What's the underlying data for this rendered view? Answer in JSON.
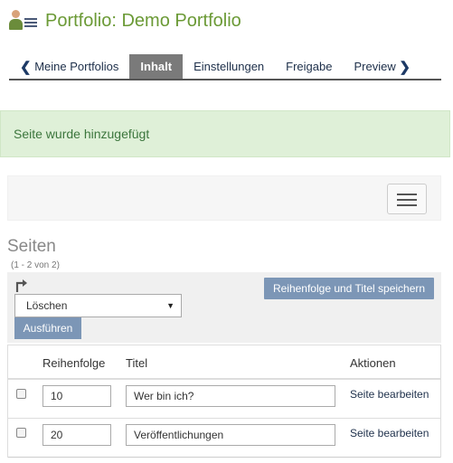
{
  "header": {
    "title": "Portfolio: Demo Portfolio",
    "icon": "portfolio-user-icon"
  },
  "tabs": {
    "back": "Meine Portfolios",
    "content": "Inhalt",
    "settings": "Einstellungen",
    "share": "Freigabe",
    "preview": "Preview"
  },
  "alert": {
    "text": "Seite wurde hinzugefügt"
  },
  "pages": {
    "heading": "Seiten",
    "count": "(1 - 2 von 2)",
    "save_button": "Reihenfolge und Titel speichern",
    "bulk_select": "Löschen",
    "run_button": "Ausführen",
    "columns": {
      "order": "Reihenfolge",
      "title": "Titel",
      "actions": "Aktionen"
    },
    "rows": [
      {
        "order": "10",
        "title": "Wer bin ich?",
        "action": "Seite bearbeiten"
      },
      {
        "order": "20",
        "title": "Veröffentlichungen",
        "action": "Seite bearbeiten"
      }
    ]
  },
  "colors": {
    "accent_green": "#6b9a36",
    "button_blue": "#7c96b6",
    "alert_bg": "#dff0d8"
  }
}
